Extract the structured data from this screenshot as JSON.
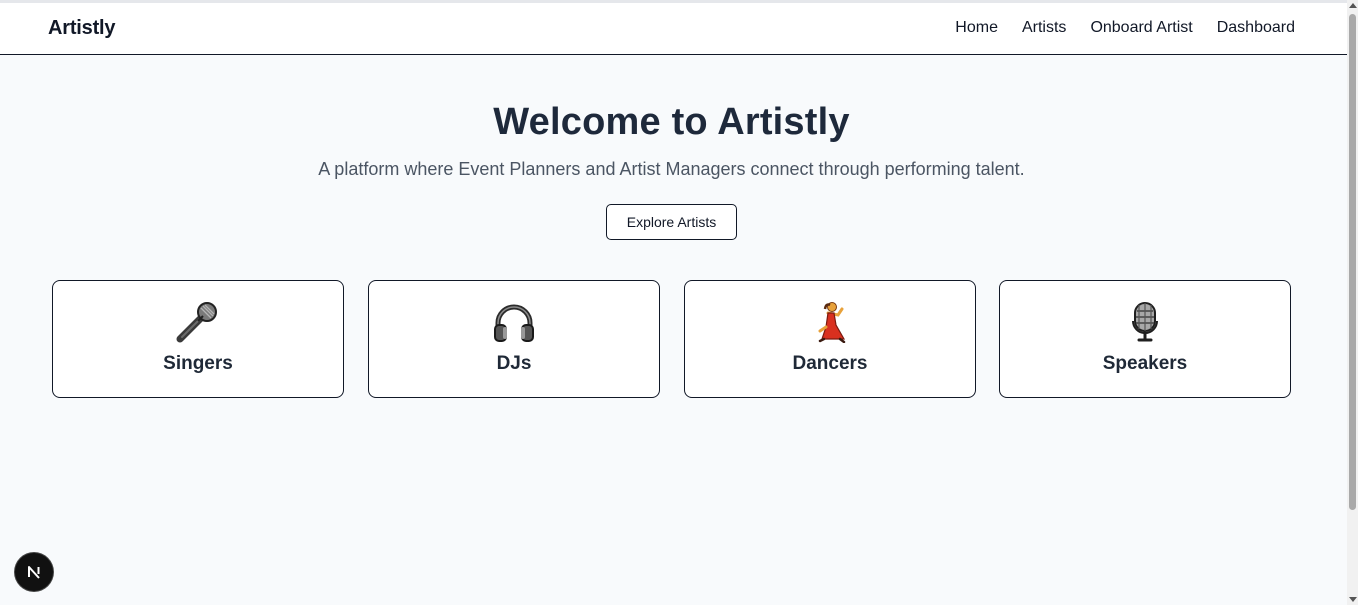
{
  "header": {
    "brand": "Artistly",
    "nav": [
      "Home",
      "Artists",
      "Onboard Artist",
      "Dashboard"
    ]
  },
  "hero": {
    "title": "Welcome to Artistly",
    "subtitle": "A platform where Event Planners and Artist Managers connect through performing talent.",
    "cta_label": "Explore Artists"
  },
  "categories": [
    {
      "label": "Singers",
      "icon": "microphone-icon"
    },
    {
      "label": "DJs",
      "icon": "headphones-icon"
    },
    {
      "label": "Dancers",
      "icon": "dancer-icon"
    },
    {
      "label": "Speakers",
      "icon": "studio-microphone-icon"
    }
  ],
  "badge": {
    "letter": "N",
    "icon": "nextjs-icon"
  },
  "colors": {
    "background": "#f8fafc",
    "text": "#1e293b",
    "border": "#111827",
    "badge": "#111111"
  }
}
